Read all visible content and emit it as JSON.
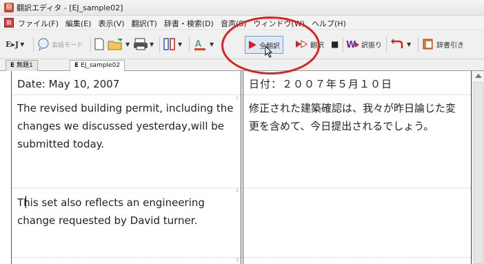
{
  "window": {
    "title": "翻訳エディタ - [EJ_sample02]",
    "app_icon": "翻"
  },
  "menu": {
    "doc_icon": "翻",
    "items": [
      "ファイル(F)",
      "編集(E)",
      "表示(V)",
      "翻訳(T)",
      "辞書・検索(D)",
      "音声(S)",
      "ウィンドウ(W)",
      "ヘルプ(H)"
    ]
  },
  "toolbar": {
    "direction": "E▸J",
    "conversation_mode": "会話モード",
    "translate_all": "全翻訳",
    "translate": "翻訳",
    "stop": "■",
    "split_translation": "訳振り",
    "dictionary_lookup": "辞書引き"
  },
  "tabs": [
    {
      "prefix": "E",
      "label": "無題1",
      "active": false
    },
    {
      "prefix": "E",
      "label": "EJ_sample02",
      "active": true
    }
  ],
  "source": [
    "Date: May 10, 2007",
    "The revised building permit, including the changes we discussed yesterday,will be submitted today.",
    "This set also reflects an engineering change requested by David turner."
  ],
  "target": [
    "日付：２００７年５月１０日",
    "修正された建築確認は、我々が昨日論じた変更を含めて、今日提出されるでしょう。",
    ""
  ],
  "segment_numbers": [
    "1",
    "2",
    "3"
  ],
  "colors": {
    "highlight": "#e02020",
    "play_icon": "#d61f1f"
  }
}
